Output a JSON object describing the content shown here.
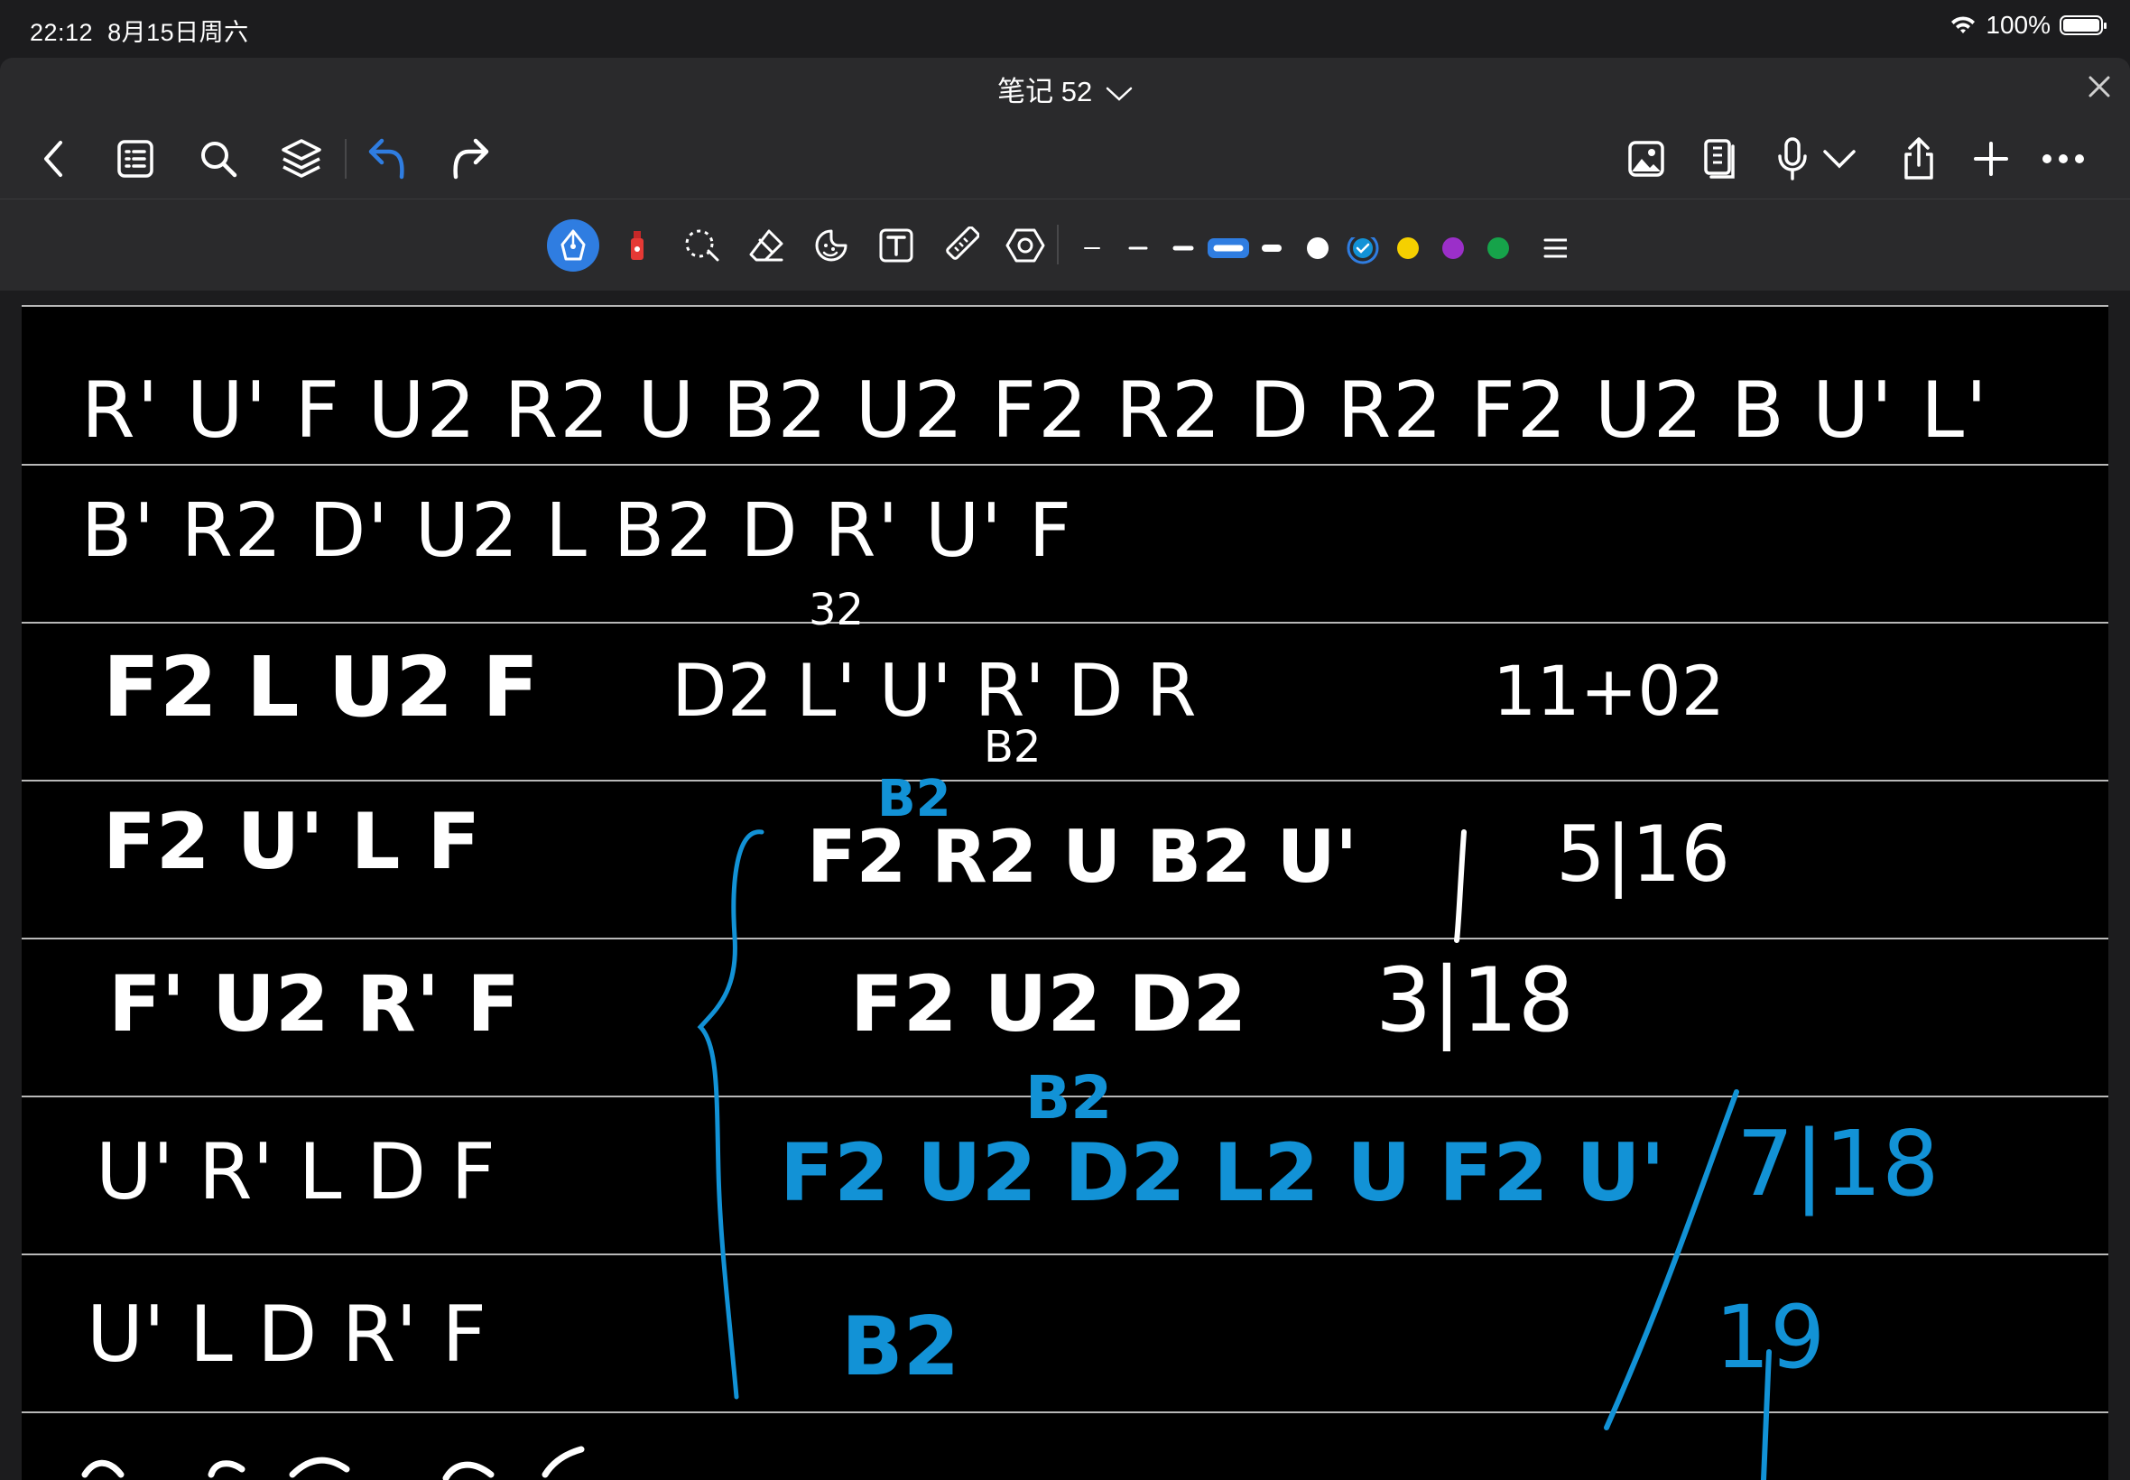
{
  "status": {
    "time": "22:12",
    "date": "8月15日周六",
    "battery": "100%"
  },
  "document": {
    "title": "笔记 52"
  },
  "colors": {
    "accent": "#2f7de1",
    "ink_blue": "#1292d6",
    "swatch_yellow": "#f5d000",
    "swatch_purple": "#9b2fc9",
    "swatch_green": "#16a34a"
  },
  "navbar": {
    "left_icons": [
      "back-icon",
      "outline-icon",
      "search-icon",
      "layers-icon",
      "undo-icon",
      "redo-icon"
    ],
    "right_icons": [
      "insert-image-icon",
      "page-view-icon",
      "microphone-icon",
      "chevron-down-icon",
      "share-icon",
      "add-page-icon",
      "more-icon"
    ]
  },
  "toolbar": {
    "tools": [
      "pen-tool-icon",
      "highlighter-icon",
      "lasso-icon",
      "eraser-icon",
      "sticker-icon",
      "text-tool-icon",
      "ruler-icon",
      "shape-tool-icon"
    ],
    "swatches": [
      "white",
      "blue",
      "yellow",
      "purple",
      "green"
    ]
  },
  "note": {
    "line1": "R' U' F U2 R2 U B2 U2 F2 R2 D R2 F2 U2 B U' L'",
    "line2": "B' R2 D' U2 L B2 D R' U' F",
    "line3_left": "F2 L U2 F",
    "line3_mid": "D2 L' U' R' D R",
    "line3_sup": "32",
    "line3_sub": "B2",
    "line3_right": "11+02",
    "line4_left": "F2 U' L F",
    "line4_mid": "F2 R2 U B2 U'",
    "line4_sup": "B2",
    "line4_right": "5|16",
    "line5_left": "F' U2 R' F",
    "line5_mid": "F2 U2 D2",
    "line5_right": "3|18",
    "line6_sup": "B2",
    "line6_left": "U' R' L D F",
    "line6_mid": "F2 U2 D2 L2 U F2 U'",
    "line6_right": "7|18",
    "line7_left": "U' L D R' F",
    "line7_mid": "B2",
    "line7_right": "19"
  }
}
